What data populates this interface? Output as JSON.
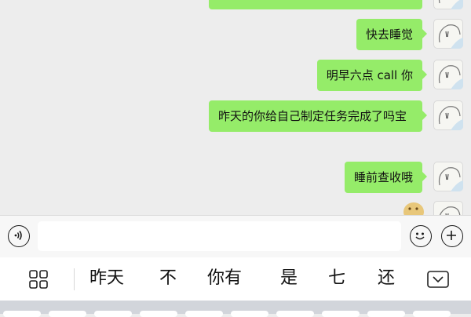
{
  "chat": {
    "messages": [
      {
        "text": ""
      },
      {
        "text": "快去睡觉"
      },
      {
        "text": "明早六点 call 你"
      },
      {
        "text": "昨天的你给自己制定任务完成了吗宝"
      },
      {
        "text": "睡前查收哦"
      }
    ]
  },
  "input_bar": {
    "placeholder": ""
  },
  "candidate_bar": {
    "candidates": [
      "昨天",
      "不",
      "你有",
      "是",
      "七",
      "还"
    ]
  },
  "colors": {
    "bubble_green": "#95ec69",
    "background": "#ededed",
    "keyboard_bg": "#d2d5db"
  },
  "icons": {
    "voice": "voice-icon",
    "emoji": "emoji-icon",
    "plus": "plus-icon",
    "grid": "grid-icon",
    "collapse": "chevron-down-icon"
  }
}
